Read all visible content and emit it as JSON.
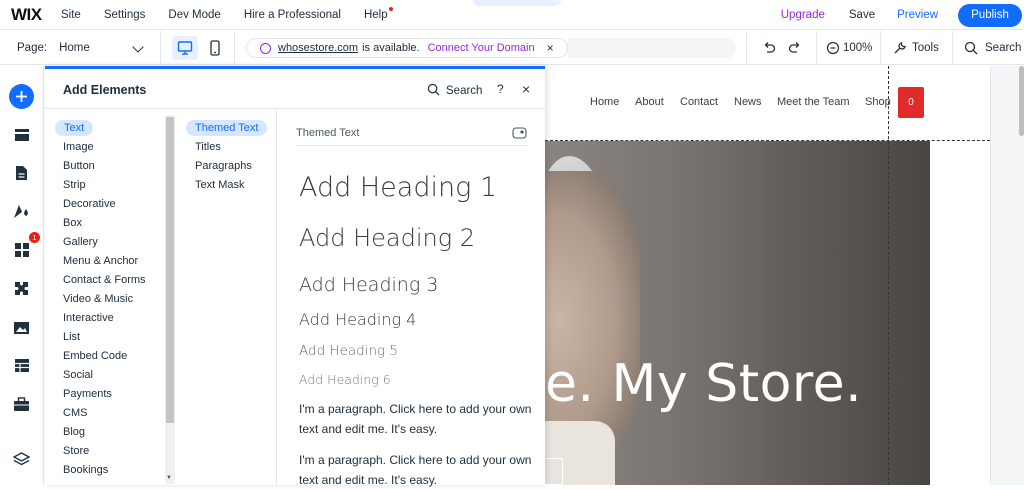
{
  "topbar": {
    "logo": "WIX",
    "menu": [
      "Site",
      "Settings",
      "Dev Mode",
      "Hire a Professional",
      "Help"
    ],
    "upgrade": "Upgrade",
    "save": "Save",
    "preview": "Preview",
    "publish": "Publish"
  },
  "secondbar": {
    "page_label": "Page:",
    "page_value": "Home",
    "url": "whosestore.com",
    "available": "is available.",
    "connect": "Connect Your Domain",
    "close": "×",
    "zoom": "100%",
    "tools": "Tools",
    "search": "Search"
  },
  "rail": {
    "badge_count": "1"
  },
  "panel": {
    "title": "Add Elements",
    "search": "Search",
    "help": "?",
    "close": "×",
    "categories": [
      "Text",
      "Image",
      "Button",
      "Strip",
      "Decorative",
      "Box",
      "Gallery",
      "Menu & Anchor",
      "Contact & Forms",
      "Video & Music",
      "Interactive",
      "List",
      "Embed Code",
      "Social",
      "Payments",
      "CMS",
      "Blog",
      "Store",
      "Bookings"
    ],
    "subcategories": [
      "Themed Text",
      "Titles",
      "Paragraphs",
      "Text Mask"
    ],
    "section_title": "Themed Text",
    "headings": [
      "Add Heading 1",
      "Add Heading 2",
      "Add Heading 3",
      "Add Heading 4",
      "Add Heading 5",
      "Add Heading 6"
    ],
    "paragraphs": [
      "I'm a paragraph. Click here to add your own text and edit me. It's easy.",
      "I'm a paragraph. Click here to add your own text and edit me. It's easy."
    ]
  },
  "site": {
    "nav": [
      "Home",
      "About",
      "Contact",
      "News",
      "Meet the Team",
      "Shop"
    ],
    "cart_count": "0",
    "hero_text": "e. My Store."
  },
  "colors": {
    "accent": "#116dff",
    "upgrade": "#9a27d5",
    "cart": "#e12a2a"
  }
}
